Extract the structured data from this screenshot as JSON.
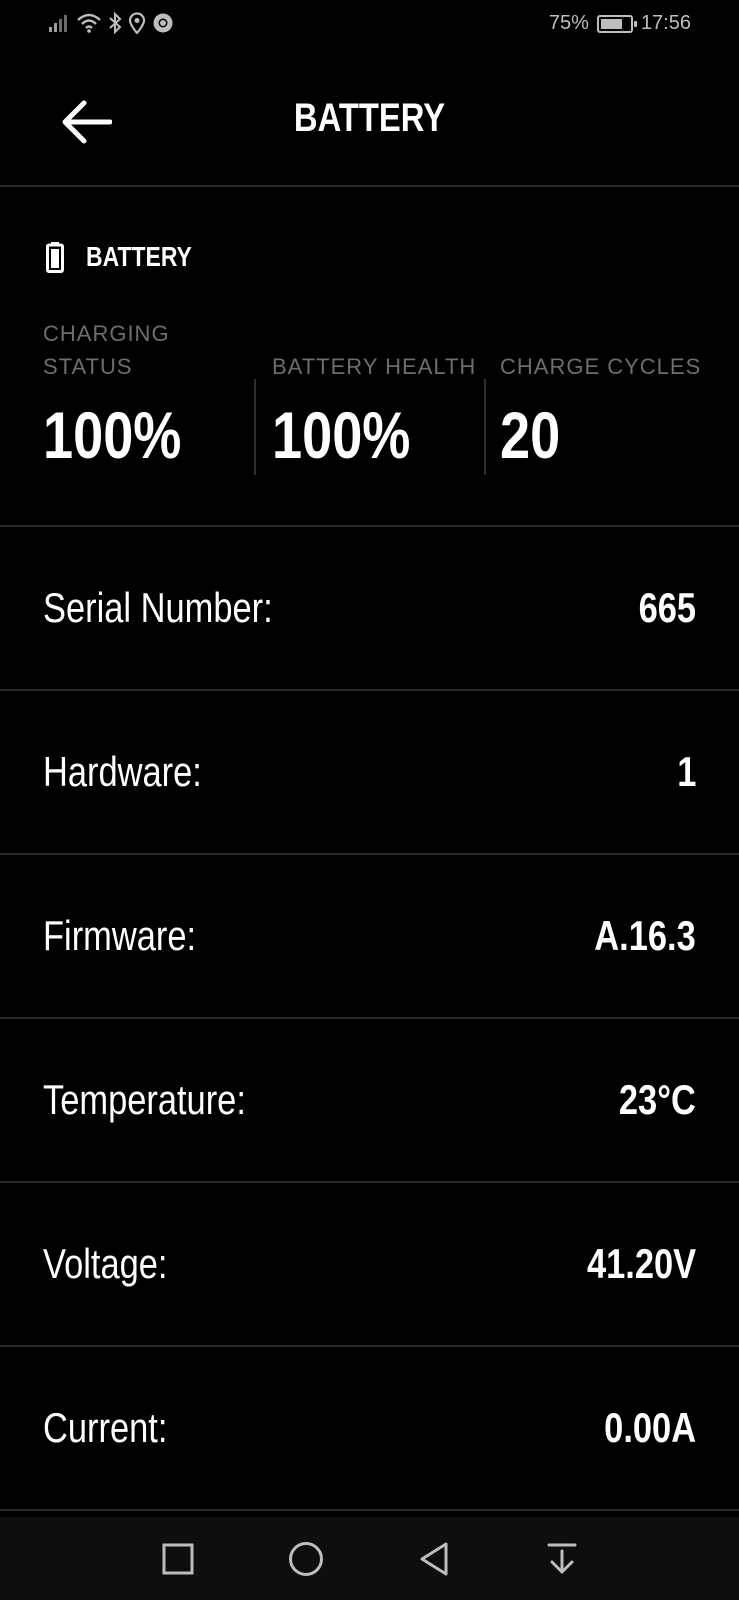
{
  "status_bar": {
    "battery_percent": "75%",
    "battery_level": 0.75,
    "time": "17:56",
    "icons": [
      "signal-icon",
      "wifi-icon",
      "bluetooth-icon",
      "location-icon",
      "chrome-icon"
    ]
  },
  "header": {
    "title": "BATTERY",
    "back_icon": "arrow-left-icon"
  },
  "battery_section": {
    "title": "BATTERY",
    "icon": "battery-icon",
    "stats": [
      {
        "label": "CHARGING STATUS",
        "value": "100%"
      },
      {
        "label": "BATTERY HEALTH",
        "value": "100%"
      },
      {
        "label": "CHARGE CYCLES",
        "value": "20"
      }
    ]
  },
  "details": [
    {
      "label": "Serial Number:",
      "value": "665"
    },
    {
      "label": "Hardware:",
      "value": "1"
    },
    {
      "label": "Firmware:",
      "value": "A.16.3"
    },
    {
      "label": "Temperature:",
      "value": "23°C"
    },
    {
      "label": "Voltage:",
      "value": "41.20V"
    },
    {
      "label": "Current:",
      "value": "0.00A"
    }
  ],
  "nav_bar": {
    "buttons": [
      "recents-square-icon",
      "home-circle-icon",
      "back-triangle-icon",
      "notification-pull-down-icon"
    ]
  },
  "colors": {
    "background": "#000000",
    "text": "#ffffff",
    "muted_label": "#6d6d6d",
    "divider": "#2a2a2a"
  }
}
